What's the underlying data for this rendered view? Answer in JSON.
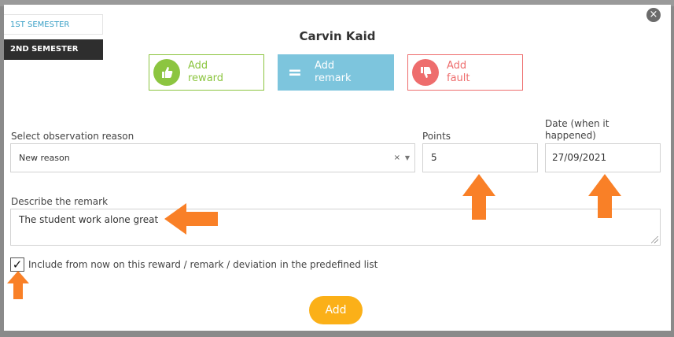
{
  "semesters": [
    {
      "label": "1ST SEMESTER"
    },
    {
      "label": "2ND SEMESTER"
    }
  ],
  "student_name": "Carvin Kaid",
  "types": {
    "reward": {
      "label": "Add\nreward",
      "icon": "thumbs-up-icon",
      "color": "#8cc540"
    },
    "remark": {
      "label": "Add\nremark",
      "icon": "equals-icon",
      "symbol": "=",
      "color": "#7dc5dd"
    },
    "fault": {
      "label": "Add\nfault",
      "icon": "thumbs-down-icon",
      "color": "#ee6d6d"
    }
  },
  "reason": {
    "label": "Select observation reason",
    "value": "New reason",
    "clear": "×",
    "caret": "▼"
  },
  "points": {
    "label": "Points",
    "value": "5"
  },
  "date": {
    "label": "Date (when it\nhappened)",
    "value": "27/09/2021"
  },
  "description": {
    "label": "Describe the remark",
    "value": "The student work alone great"
  },
  "predefined": {
    "checked": true,
    "label": "Include from now on this reward / remark / deviation in the predefined list"
  },
  "add_button": {
    "label": "Add"
  },
  "close_icon": "×",
  "colors": {
    "accent": "#fbb018",
    "annotation_arrow": "#f98027"
  }
}
